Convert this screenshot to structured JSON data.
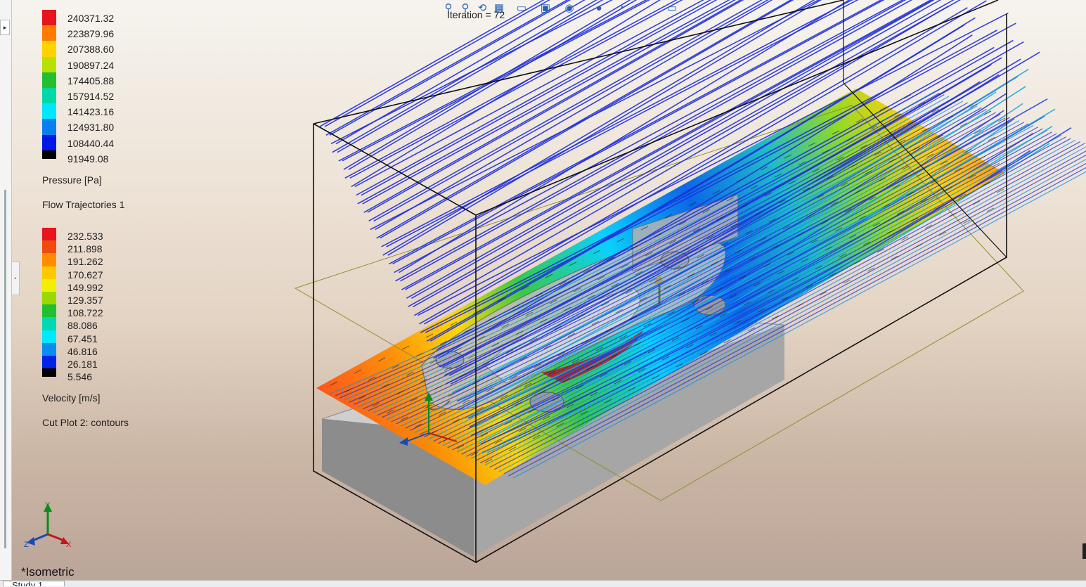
{
  "pressure_legend": {
    "values": [
      "240371.32",
      "223879.96",
      "207388.60",
      "190897.24",
      "174405.88",
      "157914.52",
      "141423.16",
      "124931.80",
      "108440.44",
      "91949.08"
    ],
    "colors": [
      "#e8141e",
      "#ff7a00",
      "#ffd200",
      "#b8e000",
      "#22c030",
      "#00d8a8",
      "#00e6ff",
      "#0a7ef0",
      "#0018e6",
      "#000000"
    ],
    "title": "Pressure [Pa]"
  },
  "trajectories": {
    "label": "Flow Trajectories 1"
  },
  "velocity_legend": {
    "values": [
      "232.533",
      "211.898",
      "191.262",
      "170.627",
      "149.992",
      "129.357",
      "108.722",
      "88.086",
      "67.451",
      "46.816",
      "26.181",
      "5.546"
    ],
    "colors": [
      "#e8141e",
      "#f04a10",
      "#ff8c00",
      "#ffc800",
      "#f0f000",
      "#9ad800",
      "#22c030",
      "#00d8b4",
      "#00e8ff",
      "#0a8cf0",
      "#0022e8",
      "#000000"
    ],
    "title": "Velocity [m/s]"
  },
  "cut_plot": {
    "label": "Cut Plot 2: contours"
  },
  "iteration": {
    "text": "Iteration = 72"
  },
  "view": {
    "name": "*Isometric"
  },
  "triad": {
    "x": "X",
    "y": "Y",
    "z": "Z"
  },
  "heads_up_toolbar": {
    "icons": [
      "zoom-to-fit-icon",
      "zoom-area-icon",
      "previous-view-icon",
      "section-view-icon",
      "view-orientation-icon",
      "display-style-icon",
      "hide-show-items-icon",
      "edit-appearance-icon",
      "apply-scene-icon",
      "view-settings-icon"
    ]
  },
  "bottom_tab": {
    "label": "Study 1"
  },
  "accent_colors": {
    "streamline": "#1f2fd8",
    "box_edge": "#111111",
    "plane_outline": "#8f8f2a"
  }
}
